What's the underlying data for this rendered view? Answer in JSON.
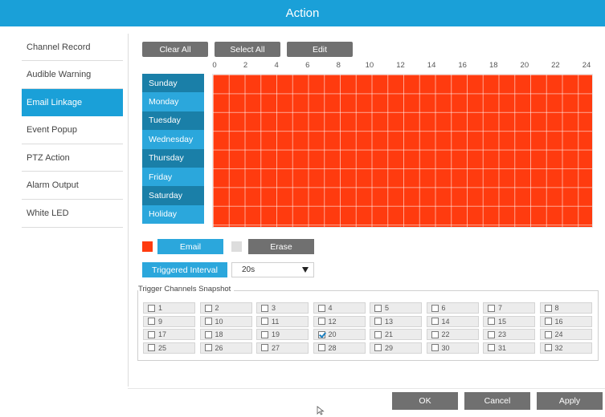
{
  "title": "Action",
  "sidebar": {
    "items": [
      {
        "label": "Channel Record"
      },
      {
        "label": "Audible Warning"
      },
      {
        "label": "Email Linkage"
      },
      {
        "label": "Event Popup"
      },
      {
        "label": "PTZ Action"
      },
      {
        "label": "Alarm Output"
      },
      {
        "label": "White LED"
      }
    ],
    "active_index": 2
  },
  "toolbar": {
    "clear_all": "Clear All",
    "select_all": "Select All",
    "edit": "Edit"
  },
  "schedule": {
    "hour_labels": [
      "0",
      "2",
      "4",
      "6",
      "8",
      "10",
      "12",
      "14",
      "16",
      "18",
      "20",
      "22",
      "24"
    ],
    "days": [
      "Sunday",
      "Monday",
      "Tuesday",
      "Wednesday",
      "Thursday",
      "Friday",
      "Saturday",
      "Holiday"
    ],
    "all_selected": true,
    "fill_color": "#ff3b0f"
  },
  "legend": {
    "email_label": "Email",
    "email_color": "#ff3b0f",
    "erase_label": "Erase",
    "erase_color": "#dddddd"
  },
  "interval": {
    "label": "Triggered Interval",
    "value": "20s"
  },
  "snapshot": {
    "title": "Trigger Channels Snapshot",
    "channels": [
      "1",
      "2",
      "3",
      "4",
      "5",
      "6",
      "7",
      "8",
      "9",
      "10",
      "11",
      "12",
      "13",
      "14",
      "15",
      "16",
      "17",
      "18",
      "19",
      "20",
      "21",
      "22",
      "23",
      "24",
      "25",
      "26",
      "27",
      "28",
      "29",
      "30",
      "31",
      "32"
    ],
    "checked": [
      "20"
    ]
  },
  "footer": {
    "ok": "OK",
    "cancel": "Cancel",
    "apply": "Apply"
  },
  "colors": {
    "accent": "#1aa0d8",
    "day_dark": "#1a7fa8",
    "day_light": "#2ba7dc",
    "button_dark": "#707070"
  }
}
